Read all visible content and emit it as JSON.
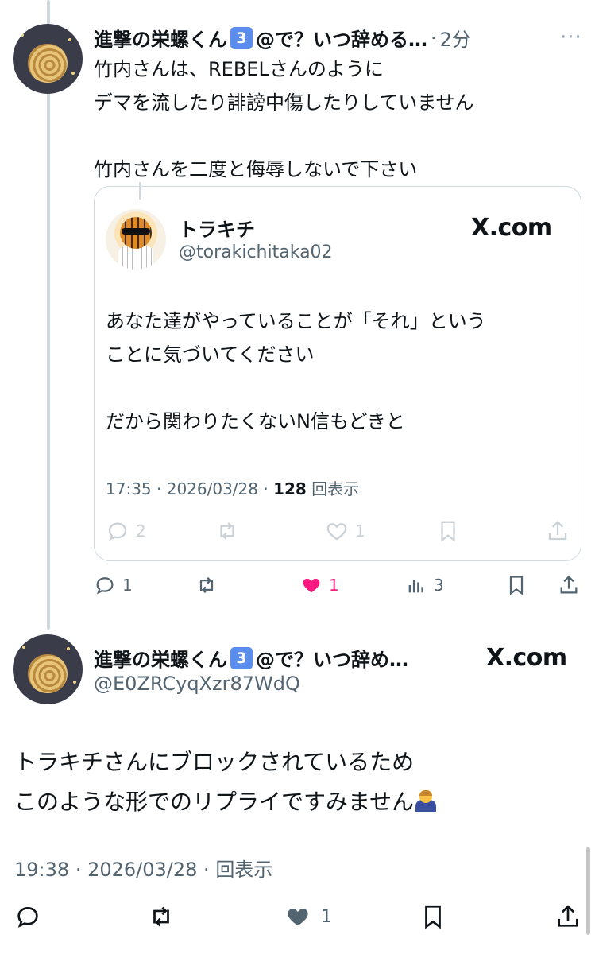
{
  "post1": {
    "display_name": "進撃の栄螺くん",
    "badge": "3",
    "name_suffix": "@で？いつ辞める…",
    "time": "2分",
    "more_label": "···",
    "lines": [
      "竹内さんは、REBELさんのように",
      "デマを流したり誹謗中傷したりしていません",
      "竹内さんを二度と侮辱しないで下さい"
    ],
    "quote": {
      "name": "トラキチ",
      "handle": "@torakichitaka02",
      "xcom": "X.com",
      "lines": [
        "あなた達がやっていることが「それ」という",
        "ことに気づいてください",
        "だから関わりたくないN信もどきと"
      ],
      "time": "17:35",
      "date": "2026/03/28",
      "views_count": "128",
      "views_label": "回表示",
      "replies": "2",
      "likes": "1"
    },
    "actions": {
      "replies": "1",
      "likes": "1",
      "views": "3"
    }
  },
  "post2": {
    "display_name": "進撃の栄螺くん",
    "badge": "3",
    "name_suffix": "@で？いつ辞め…",
    "handle": "@E0ZRCyqXzr87WdQ",
    "xcom": "X.com",
    "lines": [
      "トラキチさんにブロックされているため",
      "このような形でのリプライですみません"
    ],
    "emoji": "person-bowing-emoji",
    "time": "19:38",
    "date": "2026/03/28",
    "views_label": "回表示",
    "actions": {
      "likes": "1"
    }
  },
  "colors": {
    "accent_like": "#f91880",
    "muted": "#536471",
    "border": "#cfd9de"
  },
  "icons": [
    "reply-icon",
    "retweet-icon",
    "heart-icon",
    "views-icon",
    "bookmark-icon",
    "share-icon",
    "more-icon"
  ]
}
